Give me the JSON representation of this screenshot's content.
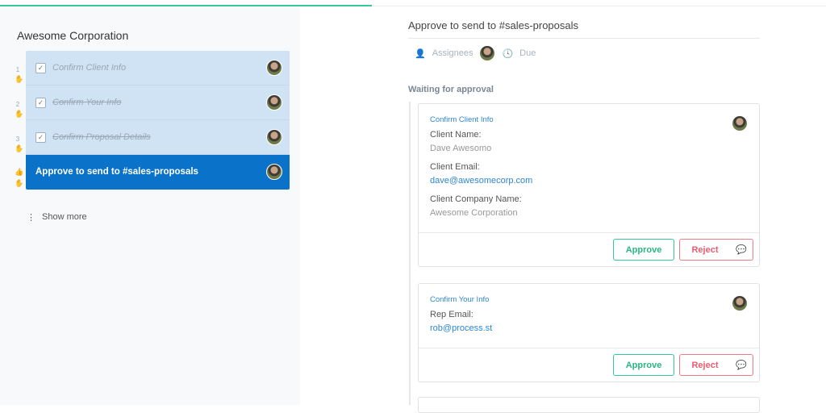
{
  "progress": {
    "percent": 45
  },
  "sidebar": {
    "title": "Awesome Corporation",
    "steps": [
      {
        "number": "1",
        "label": "Confirm Client Info",
        "completed": true
      },
      {
        "number": "2",
        "label": "Confirm Your Info",
        "completed": true
      },
      {
        "number": "3",
        "label": "Confirm Proposal Details",
        "completed": true
      },
      {
        "number": "",
        "label": "Approve to send to #sales-proposals",
        "completed": false,
        "active": true
      }
    ],
    "show_more": "Show more"
  },
  "main": {
    "title": "Approve to send to #sales-proposals",
    "assignees_label": "Assignees",
    "due_label": "Due",
    "section_label": "Waiting for approval",
    "cards": [
      {
        "form_name": "Confirm Client Info",
        "fields": [
          {
            "label": "Client Name:",
            "value": "Dave Awesomo"
          },
          {
            "label": "Client Email:",
            "value": "dave@awesomecorp.com"
          },
          {
            "label": "Client Company Name:",
            "value": "Awesome Corporation"
          }
        ],
        "approve_label": "Approve",
        "reject_label": "Reject"
      },
      {
        "form_name": "Confirm Your Info",
        "fields": [
          {
            "label": "Rep Email:",
            "value": "rob@process.st"
          }
        ],
        "approve_label": "Approve",
        "reject_label": "Reject"
      }
    ]
  },
  "colors": {
    "accent": "#0a72c9",
    "approve": "#34c89a",
    "reject": "#ec5b70"
  }
}
